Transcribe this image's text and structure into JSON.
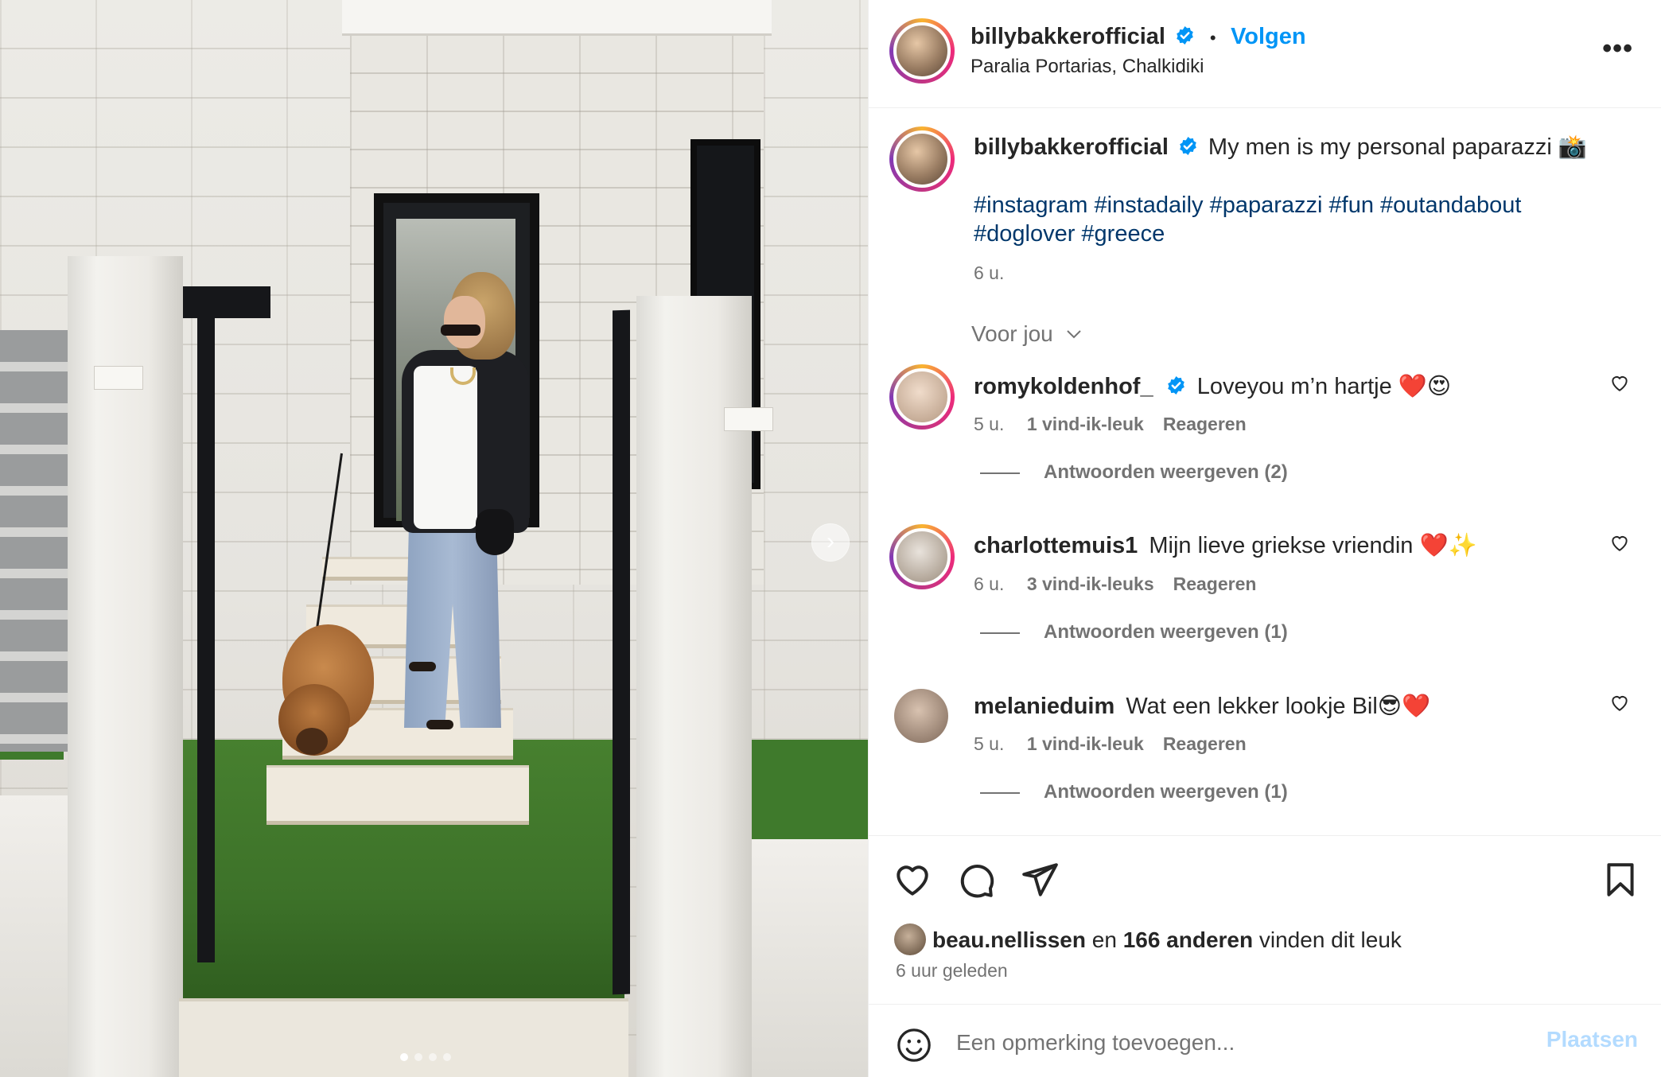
{
  "post": {
    "username": "billybakkerofficial",
    "verified_icon": "verified-badge-icon",
    "follow_label": "Volgen",
    "location": "Paralia Portarias, Chalkidiki",
    "more_icon": "more-options-icon",
    "caption": "My men is my personal paparazzi 📸",
    "hashtags": "#instagram #instadaily #paparazzi #fun #outandabout #doglover #greece",
    "time": "6 u."
  },
  "comments_header": {
    "label": "Voor jou"
  },
  "comments": [
    {
      "username": "romykoldenhof_",
      "verified": true,
      "text": "Loveyou m’n hartje ❤️😍",
      "time": "5 u.",
      "likes": "1 vind-ik-leuk",
      "reply": "Reageren",
      "replies": "Antwoorden weergeven (2)"
    },
    {
      "username": "charlottemuis1",
      "verified": false,
      "text": "Mijn lieve griekse vriendin ❤️✨",
      "time": "6 u.",
      "likes": "3 vind-ik-leuks",
      "reply": "Reageren",
      "replies": "Antwoorden weergeven (1)"
    },
    {
      "username": "melanieduim",
      "verified": false,
      "text": "Wat een lekker lookje Bil😎❤️",
      "time": "5 u.",
      "likes": "1 vind-ik-leuk",
      "reply": "Reageren",
      "replies": "Antwoorden weergeven (1)"
    }
  ],
  "actions": {
    "like_icon": "heart-icon",
    "comment_icon": "comment-icon",
    "share_icon": "send-icon",
    "save_icon": "bookmark-icon"
  },
  "likes_summary": {
    "user": "beau.nellissen",
    "connector": "en",
    "others": "166 anderen",
    "suffix": "vinden dit leuk"
  },
  "posted_ago": "6 uur geleden",
  "add_comment": {
    "emoji_icon": "emoji-icon",
    "placeholder": "Een opmerking toevoegen...",
    "post_label": "Plaatsen"
  },
  "carousel": {
    "next_icon": "chevron-right-icon",
    "slides": 4,
    "active_slide": 1
  },
  "colors": {
    "accent": "#0095f6",
    "hashtag": "#00376b",
    "muted": "#737373",
    "post_disabled": "#b3dbff"
  }
}
